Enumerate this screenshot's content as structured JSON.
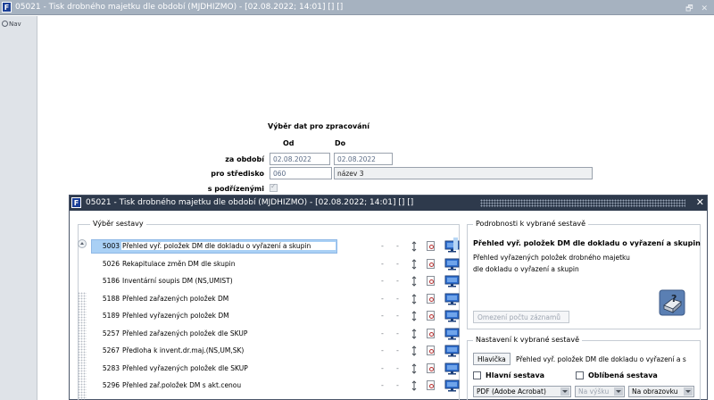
{
  "main_window": {
    "title": "05021 - Tisk drobného majetku dle období (MJDHIZMO) - [02.08.2022; 14:01] [] []",
    "controls": "🗗 ✕"
  },
  "nav": {
    "label": "Nav"
  },
  "form": {
    "heading": "Výběr dat pro zpracování",
    "col_from": "Od",
    "col_to": "Do",
    "period_label": "za období",
    "period_from": "02.08.2022",
    "period_to": "02.08.2022",
    "center_label": "pro středisko",
    "center_code": "060",
    "center_name": "název 3",
    "subordinates_label": "s podřízenými"
  },
  "dialog": {
    "title": "05021 - Tisk drobného majetku dle období (MJDHIZMO) - [02.08.2022; 14:01] [] []",
    "close": "✕",
    "report_group_title": "Výběr sestavy",
    "reports": [
      {
        "code": "5003",
        "title": "Přehled vyř. položek DM dle dokladu o vyřazení a skupin",
        "selected": true
      },
      {
        "code": "5026",
        "title": "Rekapitulace změn DM dle skupin",
        "selected": false
      },
      {
        "code": "5186",
        "title": "Inventární soupis DM (NS,UMIST)",
        "selected": false
      },
      {
        "code": "5188",
        "title": "Přehled zařazených položek DM",
        "selected": false
      },
      {
        "code": "5189",
        "title": "Přehled vyřazených položek DM",
        "selected": false
      },
      {
        "code": "5257",
        "title": "Přehled zařazených položek dle SKUP",
        "selected": false
      },
      {
        "code": "5267",
        "title": "Předloha k invent.dr.maj.(NS,UM,SK)",
        "selected": false
      },
      {
        "code": "5283",
        "title": "Přehled vyřazených položek dle SKUP",
        "selected": false
      },
      {
        "code": "5296",
        "title": "Přehled zař.položek DM s akt.cenou",
        "selected": false
      }
    ],
    "row_dash": "-",
    "details": {
      "group_title": "Podrobnosti k vybrané sestavě",
      "report_title": "Přehled vyř. položek DM dle dokladu o vyřazení a skupin",
      "desc_line1": "Přehled vyřazených položek drobného majetku",
      "desc_line2": "dle dokladu o vyřazení a skupin",
      "limit_button": "Omezení počtu záznamů"
    },
    "settings": {
      "group_title": "Nastavení k vybrané sestavě",
      "header_button": "Hlavička",
      "header_value": "Přehled vyř. položek DM dle dokladu o vyřazení a s",
      "main_report_label": "Hlavní sestava",
      "favorite_label": "Oblíbená sestava",
      "format_value": "PDF (Adobe Acrobat)",
      "height_value": "Na výšku",
      "output_value": "Na obrazovku"
    }
  }
}
